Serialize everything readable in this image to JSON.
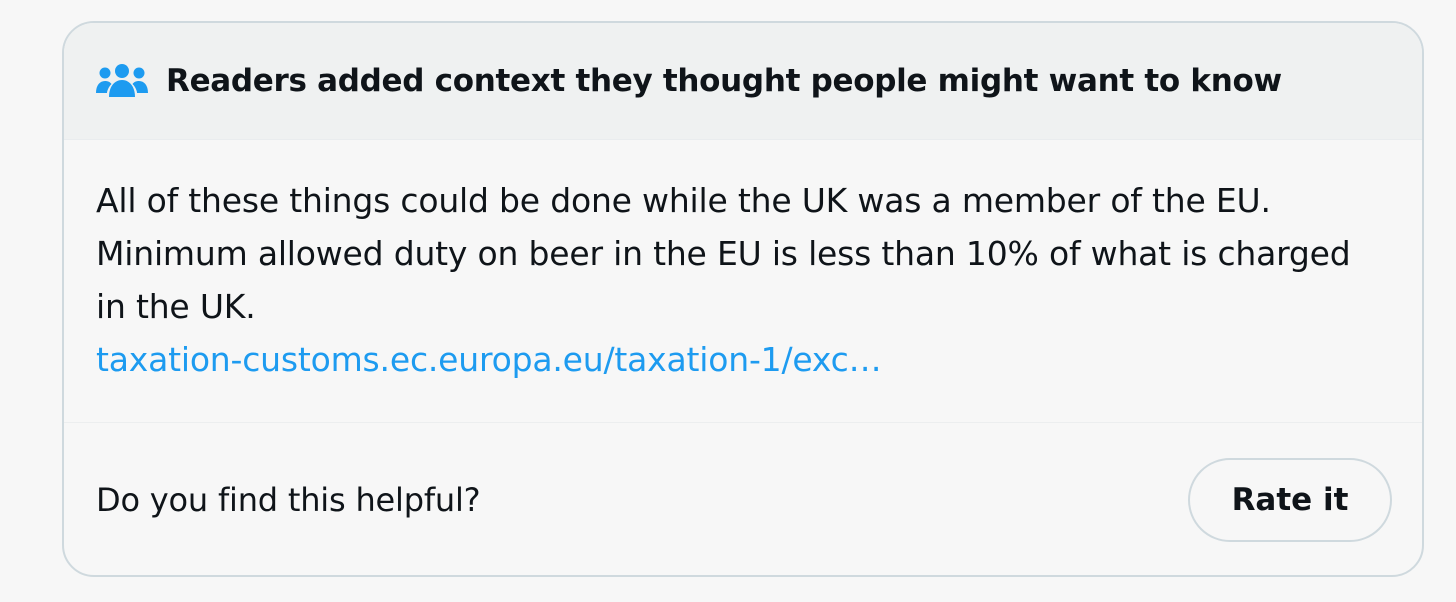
{
  "note": {
    "header_title": "Readers added context they thought people might want to know",
    "header_icon": "people-icon",
    "body_text": "All of these things could be done while the UK was a member of the EU. Minimum allowed duty on beer in the EU is less than 10% of what is charged in the UK.",
    "link_text": "taxation-customs.ec.europa.eu/taxation-1/exc…",
    "footer_question": "Do you find this helpful?",
    "rate_button_label": "Rate it"
  },
  "colors": {
    "accent": "#1d9bf0",
    "text": "#0f1419",
    "header_bg": "#eff1f1",
    "border": "#cfd9de"
  }
}
